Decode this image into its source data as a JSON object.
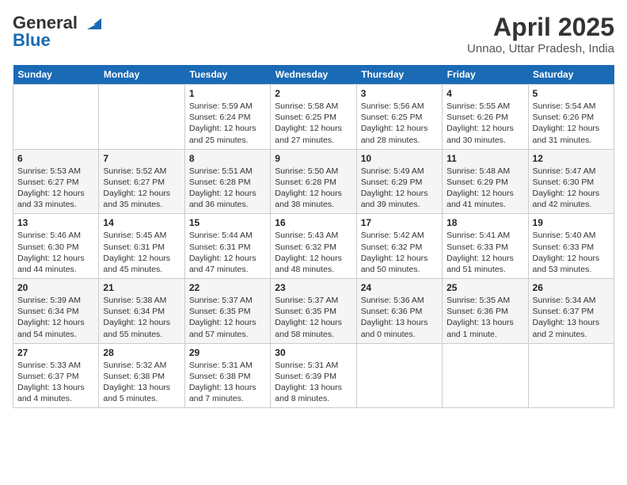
{
  "header": {
    "logo_general": "General",
    "logo_blue": "Blue",
    "month_title": "April 2025",
    "location": "Unnao, Uttar Pradesh, India"
  },
  "weekdays": [
    "Sunday",
    "Monday",
    "Tuesday",
    "Wednesday",
    "Thursday",
    "Friday",
    "Saturday"
  ],
  "weeks": [
    [
      {
        "day": "",
        "info": ""
      },
      {
        "day": "",
        "info": ""
      },
      {
        "day": "1",
        "info": "Sunrise: 5:59 AM\nSunset: 6:24 PM\nDaylight: 12 hours\nand 25 minutes."
      },
      {
        "day": "2",
        "info": "Sunrise: 5:58 AM\nSunset: 6:25 PM\nDaylight: 12 hours\nand 27 minutes."
      },
      {
        "day": "3",
        "info": "Sunrise: 5:56 AM\nSunset: 6:25 PM\nDaylight: 12 hours\nand 28 minutes."
      },
      {
        "day": "4",
        "info": "Sunrise: 5:55 AM\nSunset: 6:26 PM\nDaylight: 12 hours\nand 30 minutes."
      },
      {
        "day": "5",
        "info": "Sunrise: 5:54 AM\nSunset: 6:26 PM\nDaylight: 12 hours\nand 31 minutes."
      }
    ],
    [
      {
        "day": "6",
        "info": "Sunrise: 5:53 AM\nSunset: 6:27 PM\nDaylight: 12 hours\nand 33 minutes."
      },
      {
        "day": "7",
        "info": "Sunrise: 5:52 AM\nSunset: 6:27 PM\nDaylight: 12 hours\nand 35 minutes."
      },
      {
        "day": "8",
        "info": "Sunrise: 5:51 AM\nSunset: 6:28 PM\nDaylight: 12 hours\nand 36 minutes."
      },
      {
        "day": "9",
        "info": "Sunrise: 5:50 AM\nSunset: 6:28 PM\nDaylight: 12 hours\nand 38 minutes."
      },
      {
        "day": "10",
        "info": "Sunrise: 5:49 AM\nSunset: 6:29 PM\nDaylight: 12 hours\nand 39 minutes."
      },
      {
        "day": "11",
        "info": "Sunrise: 5:48 AM\nSunset: 6:29 PM\nDaylight: 12 hours\nand 41 minutes."
      },
      {
        "day": "12",
        "info": "Sunrise: 5:47 AM\nSunset: 6:30 PM\nDaylight: 12 hours\nand 42 minutes."
      }
    ],
    [
      {
        "day": "13",
        "info": "Sunrise: 5:46 AM\nSunset: 6:30 PM\nDaylight: 12 hours\nand 44 minutes."
      },
      {
        "day": "14",
        "info": "Sunrise: 5:45 AM\nSunset: 6:31 PM\nDaylight: 12 hours\nand 45 minutes."
      },
      {
        "day": "15",
        "info": "Sunrise: 5:44 AM\nSunset: 6:31 PM\nDaylight: 12 hours\nand 47 minutes."
      },
      {
        "day": "16",
        "info": "Sunrise: 5:43 AM\nSunset: 6:32 PM\nDaylight: 12 hours\nand 48 minutes."
      },
      {
        "day": "17",
        "info": "Sunrise: 5:42 AM\nSunset: 6:32 PM\nDaylight: 12 hours\nand 50 minutes."
      },
      {
        "day": "18",
        "info": "Sunrise: 5:41 AM\nSunset: 6:33 PM\nDaylight: 12 hours\nand 51 minutes."
      },
      {
        "day": "19",
        "info": "Sunrise: 5:40 AM\nSunset: 6:33 PM\nDaylight: 12 hours\nand 53 minutes."
      }
    ],
    [
      {
        "day": "20",
        "info": "Sunrise: 5:39 AM\nSunset: 6:34 PM\nDaylight: 12 hours\nand 54 minutes."
      },
      {
        "day": "21",
        "info": "Sunrise: 5:38 AM\nSunset: 6:34 PM\nDaylight: 12 hours\nand 55 minutes."
      },
      {
        "day": "22",
        "info": "Sunrise: 5:37 AM\nSunset: 6:35 PM\nDaylight: 12 hours\nand 57 minutes."
      },
      {
        "day": "23",
        "info": "Sunrise: 5:37 AM\nSunset: 6:35 PM\nDaylight: 12 hours\nand 58 minutes."
      },
      {
        "day": "24",
        "info": "Sunrise: 5:36 AM\nSunset: 6:36 PM\nDaylight: 13 hours\nand 0 minutes."
      },
      {
        "day": "25",
        "info": "Sunrise: 5:35 AM\nSunset: 6:36 PM\nDaylight: 13 hours\nand 1 minute."
      },
      {
        "day": "26",
        "info": "Sunrise: 5:34 AM\nSunset: 6:37 PM\nDaylight: 13 hours\nand 2 minutes."
      }
    ],
    [
      {
        "day": "27",
        "info": "Sunrise: 5:33 AM\nSunset: 6:37 PM\nDaylight: 13 hours\nand 4 minutes."
      },
      {
        "day": "28",
        "info": "Sunrise: 5:32 AM\nSunset: 6:38 PM\nDaylight: 13 hours\nand 5 minutes."
      },
      {
        "day": "29",
        "info": "Sunrise: 5:31 AM\nSunset: 6:38 PM\nDaylight: 13 hours\nand 7 minutes."
      },
      {
        "day": "30",
        "info": "Sunrise: 5:31 AM\nSunset: 6:39 PM\nDaylight: 13 hours\nand 8 minutes."
      },
      {
        "day": "",
        "info": ""
      },
      {
        "day": "",
        "info": ""
      },
      {
        "day": "",
        "info": ""
      }
    ]
  ]
}
